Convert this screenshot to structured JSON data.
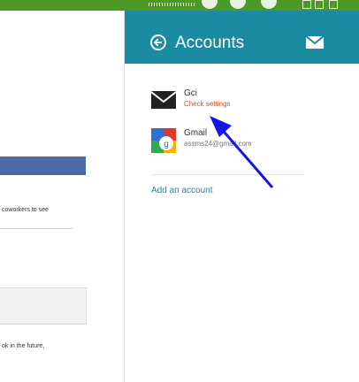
{
  "accounts_pane": {
    "title": "Accounts",
    "accounts": [
      {
        "name": "Gci",
        "status": "Check settings",
        "icon": "mail-icon"
      },
      {
        "name": "Gmail",
        "email": "assms24@gmail.com",
        "icon": "google-icon"
      }
    ],
    "add_account_label": "Add an account"
  },
  "background_app": {
    "text_line_1": "coworkers to see",
    "text_line_2": "ok in the future,"
  },
  "colors": {
    "header": "#1a8ba0",
    "warning": "#d64d20",
    "desktop": "#3f8e23",
    "annotation": "#1414e6"
  }
}
